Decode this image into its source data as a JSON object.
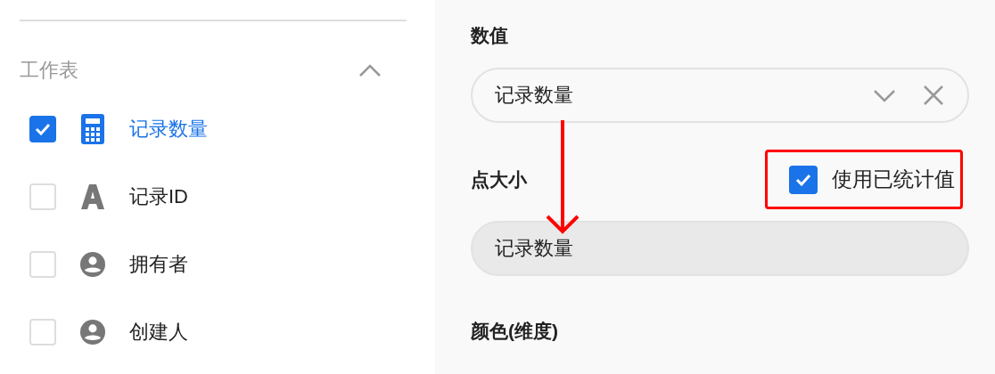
{
  "sheet_section": {
    "title": "工作表",
    "expanded": true,
    "fields": [
      {
        "kind": "calc",
        "label": "记录数量",
        "checked": true
      },
      {
        "kind": "text",
        "label": "记录ID",
        "checked": false
      },
      {
        "kind": "user",
        "label": "拥有者",
        "checked": false
      },
      {
        "kind": "user",
        "label": "创建人",
        "checked": false
      }
    ]
  },
  "settings": {
    "value": {
      "label": "数值",
      "selected": "记录数量",
      "arrow_to_size": true
    },
    "size": {
      "label": "点大小",
      "option": {
        "label": "使用已统计值",
        "checked": true,
        "highlighted": true
      },
      "value": "记录数量",
      "disabled": true
    },
    "color": {
      "label": "颜色(维度)"
    }
  }
}
